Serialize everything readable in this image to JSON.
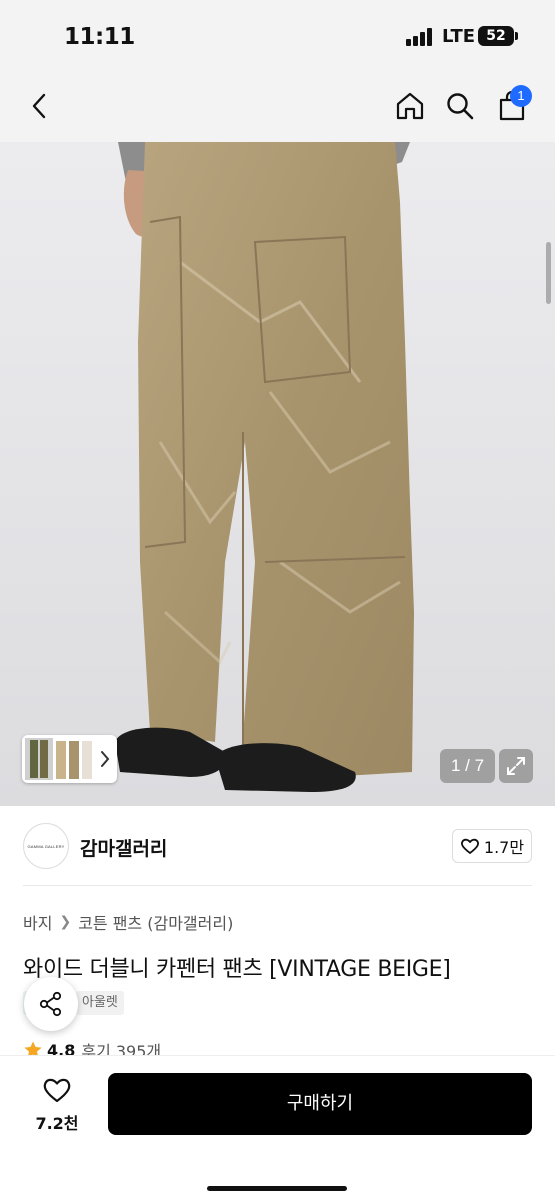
{
  "status_bar": {
    "time": "11:11",
    "network": "LTE",
    "battery": "52"
  },
  "nav": {
    "cart_badge": "1"
  },
  "gallery": {
    "counter": "1 / 7"
  },
  "brand": {
    "logo_text": "GAMMA GALLERY",
    "name": "감마갤러리",
    "like_count": "1.7만"
  },
  "breadcrumb": {
    "items": [
      "바지",
      "코튼 팬츠 (감마갤러리)"
    ]
  },
  "product": {
    "title": "와이드 더블니 카펜터 팬츠 [VINTAGE BEIGE]",
    "tag": "아울렛",
    "rating": "4.8",
    "review_label": "후기 395개"
  },
  "bottom_bar": {
    "wish_count": "7.2천",
    "buy_label": "구매하기"
  },
  "colors": {
    "accent": "#1f6bff",
    "buy_button": "#000000",
    "star": "#f5a623"
  }
}
